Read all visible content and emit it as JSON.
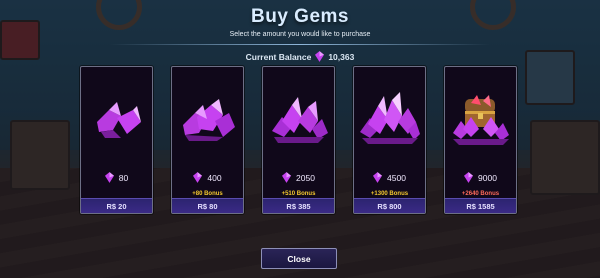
{
  "header": {
    "title": "Buy Gems",
    "subtitle": "Select the amount you would like to purchase"
  },
  "balance": {
    "label": "Current Balance",
    "value": "10,363",
    "icon": "gem-icon"
  },
  "colors": {
    "gem": "#c642f0",
    "bonus_normal": "#f3c82e",
    "bonus_best": "#ff6a5a",
    "price_bar": "#2c2470"
  },
  "packages": [
    {
      "amount": "80",
      "bonus": "",
      "price": "R$ 20",
      "icon": "small-gem-pile-icon"
    },
    {
      "amount": "400",
      "bonus": "+80 Bonus",
      "price": "R$ 80",
      "icon": "gem-pile-icon"
    },
    {
      "amount": "2050",
      "bonus": "+510 Bonus",
      "price": "R$ 385",
      "icon": "gem-cluster-icon"
    },
    {
      "amount": "4500",
      "bonus": "+1300 Bonus",
      "price": "R$ 800",
      "icon": "large-gem-cluster-icon"
    },
    {
      "amount": "9000",
      "bonus": "+2640 Bonus",
      "price": "R$ 1585",
      "icon": "treasure-chest-icon"
    }
  ],
  "close_label": "Close"
}
